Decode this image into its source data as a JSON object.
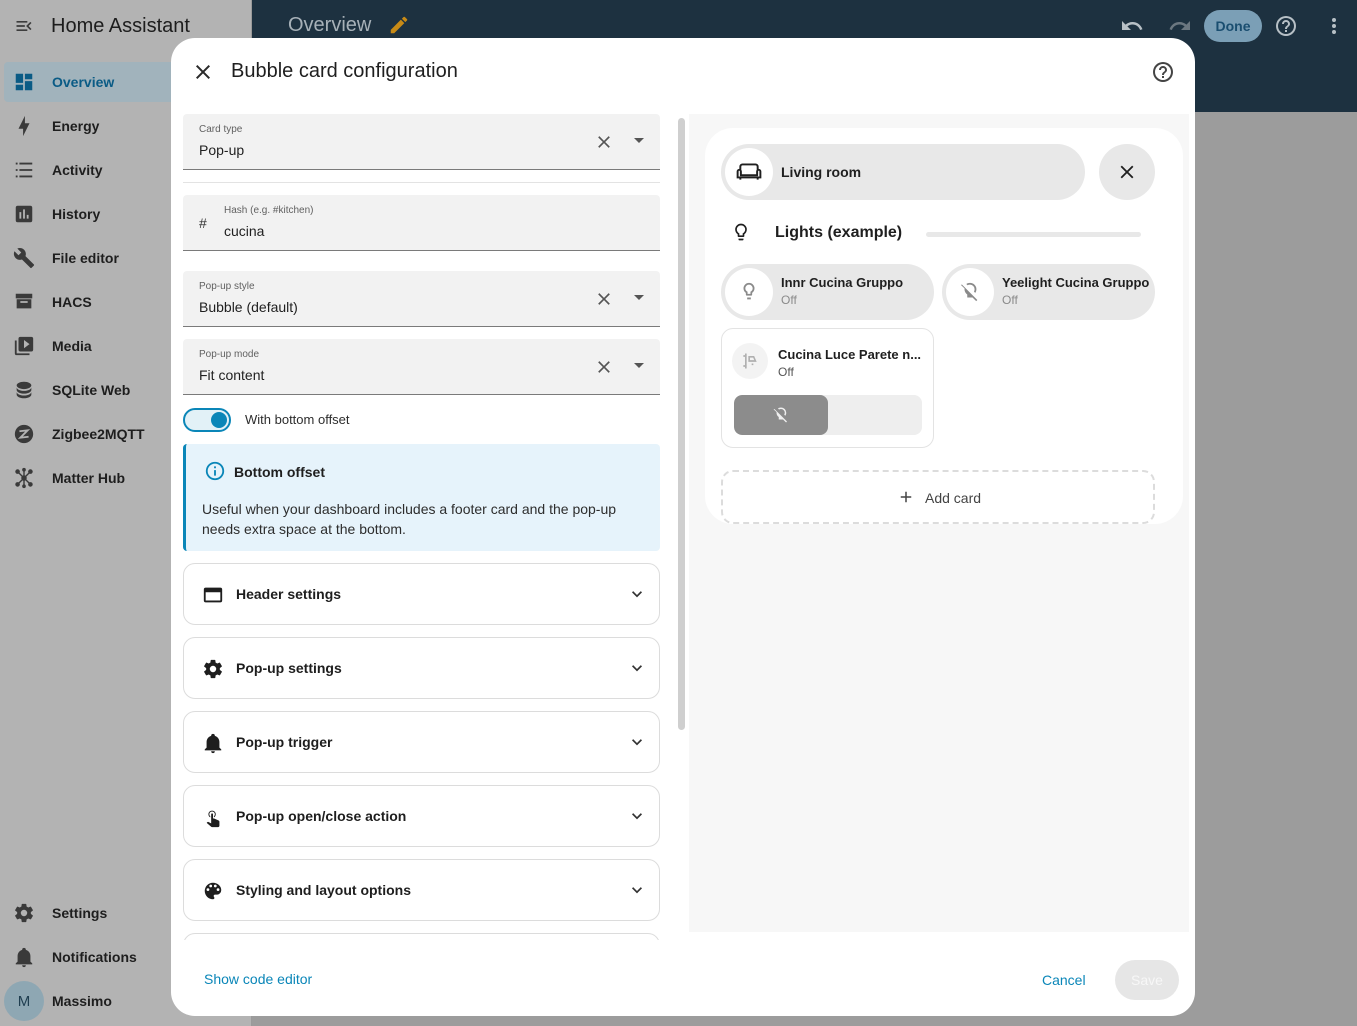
{
  "app": {
    "title": "Home Assistant"
  },
  "sidebar": {
    "items": [
      {
        "label": "Overview",
        "icon": "dashboard-icon",
        "active": true
      },
      {
        "label": "Energy",
        "icon": "lightning-icon"
      },
      {
        "label": "Activity",
        "icon": "list-icon"
      },
      {
        "label": "History",
        "icon": "chart-bar-icon"
      },
      {
        "label": "File editor",
        "icon": "wrench-icon"
      },
      {
        "label": "HACS",
        "icon": "hacs-icon"
      },
      {
        "label": "Media",
        "icon": "play-box-icon"
      },
      {
        "label": "SQLite Web",
        "icon": "database-icon"
      },
      {
        "label": "Zigbee2MQTT",
        "icon": "zigbee-icon"
      },
      {
        "label": "Matter Hub",
        "icon": "hub-icon"
      }
    ],
    "bottom_items": [
      {
        "label": "Settings",
        "icon": "gear-icon"
      },
      {
        "label": "Notifications",
        "icon": "bell-icon"
      }
    ],
    "user": {
      "initial": "M",
      "name": "Massimo"
    }
  },
  "topbar": {
    "title": "Overview",
    "done_label": "Done"
  },
  "dialog": {
    "title": "Bubble card configuration",
    "fields": {
      "card_type": {
        "label": "Card type",
        "value": "Pop-up"
      },
      "hash": {
        "label": "Hash (e.g. #kitchen)",
        "prefix": "#",
        "value": "cucina"
      },
      "popup_style": {
        "label": "Pop-up style",
        "value": "Bubble (default)"
      },
      "popup_mode": {
        "label": "Pop-up mode",
        "value": "Fit content"
      }
    },
    "toggle": {
      "label": "With bottom offset",
      "on": true
    },
    "info": {
      "title": "Bottom offset",
      "text": "Useful when your dashboard includes a footer card and the pop-up needs extra space at the bottom."
    },
    "sections": [
      {
        "label": "Header settings",
        "icon": "card-icon"
      },
      {
        "label": "Pop-up settings",
        "icon": "gear-icon"
      },
      {
        "label": "Pop-up trigger",
        "icon": "bell-icon"
      },
      {
        "label": "Pop-up open/close action",
        "icon": "touch-icon"
      },
      {
        "label": "Styling and layout options",
        "icon": "palette-icon"
      }
    ],
    "footer": {
      "show_code": "Show code editor",
      "cancel": "Cancel",
      "save": "Save"
    }
  },
  "preview": {
    "header_label": "Living room",
    "separator_label": "Lights (example)",
    "buttons": [
      {
        "name": "Innr Cucina Gruppo",
        "state": "Off"
      },
      {
        "name": "Yeelight Cucina Gruppo",
        "state": "Off"
      }
    ],
    "slider_card": {
      "name": "Cucina Luce Parete n...",
      "state": "Off",
      "fill_percent": 50
    },
    "add_card": "Add card"
  }
}
